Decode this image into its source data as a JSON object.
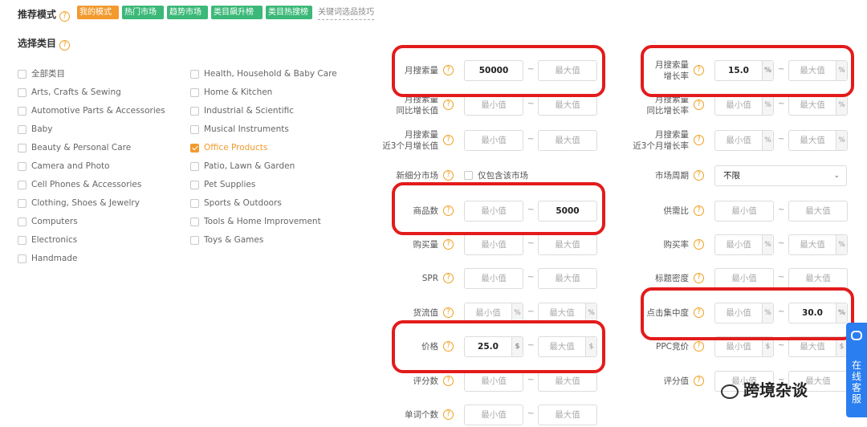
{
  "header": {
    "mode_label": "推荐模式",
    "tags": [
      {
        "label": "我的模式",
        "color": "orange"
      },
      {
        "label": "热门市场",
        "color": "green"
      },
      {
        "label": "趋势市场",
        "color": "green"
      },
      {
        "label": "类目飙升榜",
        "color": "green"
      },
      {
        "label": "类目热搜榜",
        "color": "green"
      }
    ],
    "tip_link": "关键词选品技巧",
    "category_label": "选择类目"
  },
  "categories_left": [
    {
      "label": "全部类目",
      "checked": false
    },
    {
      "label": "Arts, Crafts & Sewing",
      "checked": false
    },
    {
      "label": "Automotive Parts & Accessories",
      "checked": false
    },
    {
      "label": "Baby",
      "checked": false
    },
    {
      "label": "Beauty & Personal Care",
      "checked": false
    },
    {
      "label": "Camera and Photo",
      "checked": false
    },
    {
      "label": "Cell Phones & Accessories",
      "checked": false
    },
    {
      "label": "Clothing, Shoes & Jewelry",
      "checked": false
    },
    {
      "label": "Computers",
      "checked": false
    },
    {
      "label": "Electronics",
      "checked": false
    },
    {
      "label": "Handmade",
      "checked": false
    }
  ],
  "categories_right": [
    {
      "label": "Health, Household & Baby Care",
      "checked": false
    },
    {
      "label": "Home & Kitchen",
      "checked": false
    },
    {
      "label": "Industrial & Scientific",
      "checked": false
    },
    {
      "label": "Musical Instruments",
      "checked": false
    },
    {
      "label": "Office Products",
      "checked": true
    },
    {
      "label": "Patio, Lawn & Garden",
      "checked": false
    },
    {
      "label": "Pet Supplies",
      "checked": false
    },
    {
      "label": "Sports & Outdoors",
      "checked": false
    },
    {
      "label": "Tools & Home Improvement",
      "checked": false
    },
    {
      "label": "Toys & Games",
      "checked": false
    }
  ],
  "placeholders": {
    "min": "最小值",
    "max": "最大值"
  },
  "units": {
    "percent": "%",
    "dollar": "$"
  },
  "filters_left": [
    {
      "label": "月搜索量",
      "min": "50000",
      "max": ""
    },
    {
      "label": "月搜索量\n同比增长值",
      "min": "",
      "max": ""
    },
    {
      "label": "月搜索量\n近3个月增长值",
      "min": "",
      "max": ""
    },
    {
      "label": "新细分市场",
      "checkbox": "仅包含该市场"
    },
    {
      "label": "商品数",
      "min": "",
      "max": "5000"
    },
    {
      "label": "购买量",
      "min": "",
      "max": ""
    },
    {
      "label": "SPR",
      "min": "",
      "max": ""
    },
    {
      "label": "货流值",
      "min": "",
      "max": "",
      "unit": "%"
    },
    {
      "label": "价格",
      "min": "25.0",
      "max": "",
      "unit": "$"
    },
    {
      "label": "评分数",
      "min": "",
      "max": ""
    },
    {
      "label": "单词个数",
      "min": "",
      "max": ""
    }
  ],
  "filters_right": [
    {
      "label": "月搜索量\n增长率",
      "min": "15.0",
      "max": "",
      "unit": "%"
    },
    {
      "label": "月搜索量\n同比增长率",
      "min": "",
      "max": "",
      "unit": "%"
    },
    {
      "label": "月搜索量\n近3个月增长率",
      "min": "",
      "max": "",
      "unit": "%"
    },
    {
      "label": "市场周期",
      "select": "不限"
    },
    {
      "label": "供需比",
      "min": "",
      "max": ""
    },
    {
      "label": "购买率",
      "min": "",
      "max": "",
      "unit": "%"
    },
    {
      "label": "标题密度",
      "min": "",
      "max": ""
    },
    {
      "label": "点击集中度",
      "min": "",
      "max": "30.0",
      "unit": "%"
    },
    {
      "label": "PPC竞价",
      "min": "",
      "max": "",
      "unit": "$"
    },
    {
      "label": "评分值",
      "min": "",
      "max": ""
    }
  ],
  "side_button": "在线客服",
  "watermark": "跨境杂谈",
  "colors": {
    "accent": "#f29a2e",
    "green": "#3cb878",
    "highlight": "#e31b1b",
    "side": "#2a7ef0"
  }
}
